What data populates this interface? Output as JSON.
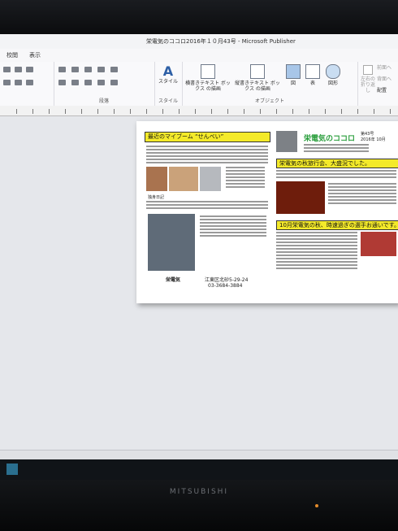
{
  "window": {
    "title": "栄電気のココロ2016年１０月43号 - Microsoft Publisher"
  },
  "menu": {
    "tabs": [
      "校閲",
      "表示"
    ]
  },
  "ribbon": {
    "groups": {
      "paragraph_label": "段落",
      "style_label": "スタイル",
      "object_label": "オブジェクト"
    },
    "buttons": {
      "style": "スタイル",
      "horizontal_textbox": "横書きテキスト ボックス の描画",
      "vertical_textbox": "縦書きテキスト ボックス の描画",
      "picture": "図",
      "table": "表",
      "shapes": "図形",
      "wrap_left": "左右の 折り返し",
      "bring_forward": "前面へ",
      "send_backward": "背面へ",
      "arrange": "配置"
    }
  },
  "newsletter": {
    "left_heading": "最近のマイブーム “せんべい”",
    "left_caption": "独身日記",
    "left_sub_heading": "栄電気",
    "address": "江東区北砂5-29-24",
    "phone": "03-3684-3884",
    "masthead": "栄電気のココロ",
    "issue_no": "第43号",
    "issue_date": "2016年 10月",
    "right_heading_1": "栄電気の秋旅行会、大盛況でした。",
    "right_heading_2": "10月栄電気の秋、時速過ぎの選手お通いです。"
  },
  "colors": {
    "highlight": "#f4ea2a",
    "masthead": "#2a9e3c"
  }
}
